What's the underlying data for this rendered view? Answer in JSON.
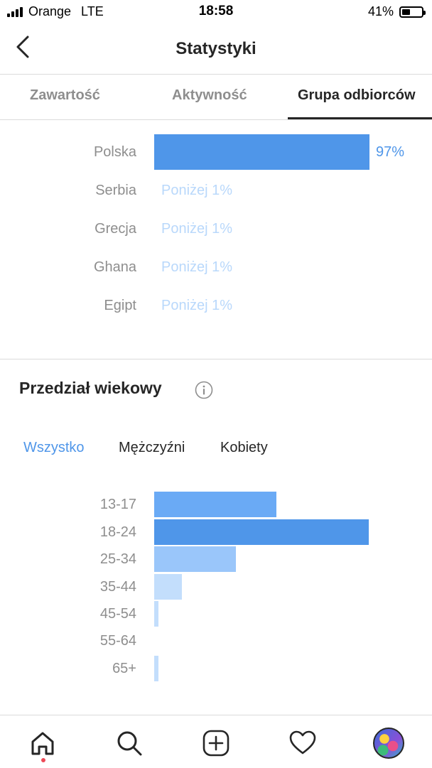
{
  "status_bar": {
    "carrier": "Orange",
    "network": "LTE",
    "time": "18:58",
    "battery_percent": "41%",
    "battery_level": 0.41
  },
  "header": {
    "title": "Statystyki",
    "back_icon": "chevron-left-icon"
  },
  "tabs": [
    {
      "label": "Zawartość",
      "active": false
    },
    {
      "label": "Aktywność",
      "active": false
    },
    {
      "label": "Grupa odbiorców",
      "active": true
    }
  ],
  "countries": [
    {
      "name": "Polska",
      "value": "97%",
      "fraction": 0.97
    },
    {
      "name": "Serbia",
      "value": "Poniżej 1%",
      "fraction": 0
    },
    {
      "name": "Grecja",
      "value": "Poniżej 1%",
      "fraction": 0
    },
    {
      "name": "Ghana",
      "value": "Poniżej 1%",
      "fraction": 0
    },
    {
      "name": "Egipt",
      "value": "Poniżej 1%",
      "fraction": 0
    }
  ],
  "age_section": {
    "title": "Przedział wiekowy",
    "info_icon": "info-icon",
    "filters": [
      {
        "label": "Wszystko",
        "active": true
      },
      {
        "label": "Mężczyźni",
        "active": false
      },
      {
        "label": "Kobiety",
        "active": false
      }
    ],
    "ranges": [
      {
        "label": "13-17",
        "fraction": 0.57,
        "color": "#6aaaf5"
      },
      {
        "label": "18-24",
        "fraction": 1.0,
        "color": "#4f96e9"
      },
      {
        "label": "25-34",
        "fraction": 0.38,
        "color": "#9ac6fa"
      },
      {
        "label": "35-44",
        "fraction": 0.13,
        "color": "#c3defc"
      },
      {
        "label": "45-54",
        "fraction": 0.02,
        "color": "#c3defc"
      },
      {
        "label": "55-64",
        "fraction": 0,
        "color": "#c3defc"
      },
      {
        "label": "65+",
        "fraction": 0.02,
        "color": "#c3defc"
      }
    ]
  },
  "bottom_nav": [
    {
      "name": "home-icon",
      "active": true
    },
    {
      "name": "search-icon",
      "active": false
    },
    {
      "name": "add-post-icon",
      "active": false
    },
    {
      "name": "heart-icon",
      "active": false
    },
    {
      "name": "profile-avatar",
      "active": false
    }
  ],
  "colors": {
    "accent": "#4f96e9",
    "faint_accent": "#b9d8fb",
    "muted_text": "#8e8e8e",
    "notification": "#ed4956"
  }
}
